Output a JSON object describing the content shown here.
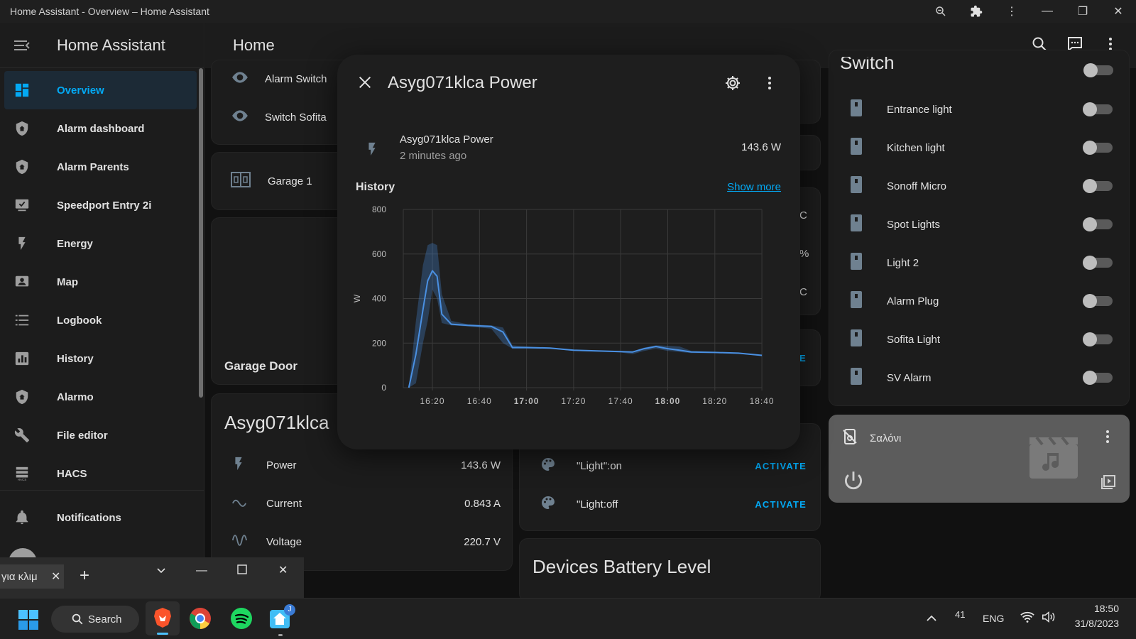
{
  "window": {
    "title": "Home Assistant - Overview – Home Assistant"
  },
  "sidebar": {
    "app_title": "Home Assistant",
    "items": [
      {
        "label": "Overview",
        "icon": "dashboard-icon",
        "active": true
      },
      {
        "label": "Alarm dashboard",
        "icon": "shield-home-icon"
      },
      {
        "label": "Alarm Parents",
        "icon": "shield-home-icon"
      },
      {
        "label": "Speedport Entry 2i",
        "icon": "monitor-icon"
      },
      {
        "label": "Energy",
        "icon": "lightning-icon"
      },
      {
        "label": "Map",
        "icon": "map-account-icon"
      },
      {
        "label": "Logbook",
        "icon": "list-icon"
      },
      {
        "label": "History",
        "icon": "chart-bar-icon"
      },
      {
        "label": "Alarmo",
        "icon": "shield-home-icon"
      },
      {
        "label": "File editor",
        "icon": "wrench-icon"
      },
      {
        "label": "HACS",
        "icon": "hacs-icon"
      }
    ],
    "notifications_label": "Notifications"
  },
  "header": {
    "title": "Home"
  },
  "left_cards": {
    "alarm_switch": "Alarm Switch",
    "switch_sofita": "Switch Sofita",
    "garage1": "Garage 1",
    "garage_door": "Garage Door",
    "asyg_title": "Asyg071klca",
    "rows": [
      {
        "label": "Power",
        "value": "143.6 W",
        "icon": "lightning-icon"
      },
      {
        "label": "Current",
        "value": "0.843 A",
        "icon": "current-ac-icon"
      },
      {
        "label": "Voltage",
        "value": "220.7 V",
        "icon": "sine-wave-icon"
      }
    ]
  },
  "middle_cards": {
    "units": [
      "C",
      "%",
      "C"
    ],
    "partial_activate": "E",
    "scenes": [
      {
        "label": "\"Light\":on",
        "action": "ACTIVATE"
      },
      {
        "label": "\"Light:off",
        "action": "ACTIVATE"
      }
    ],
    "battery_title": "Devices Battery Level"
  },
  "switch_card": {
    "title": "Switch",
    "items": [
      "Entrance light",
      "Kitchen light",
      "Sonoff Micro",
      "Spot Lights",
      "Light 2",
      "Alarm Plug",
      "Sofita Light",
      "SV Alarm"
    ]
  },
  "media_card": {
    "name": "Σαλόνι"
  },
  "dialog": {
    "title": "Asyg071klca Power",
    "entity_name": "Asyg071klca Power",
    "last_changed": "2 minutes ago",
    "state": "143.6 W",
    "history_label": "History",
    "show_more": "Show more"
  },
  "chart_data": {
    "type": "line",
    "title": "",
    "xlabel": "",
    "ylabel": "W",
    "ylim": [
      0,
      800
    ],
    "yticks": [
      0,
      200,
      400,
      600,
      800
    ],
    "xticks": [
      {
        "label": "16:20",
        "bold": false
      },
      {
        "label": "16:40",
        "bold": false
      },
      {
        "label": "17:00",
        "bold": true
      },
      {
        "label": "17:20",
        "bold": false
      },
      {
        "label": "17:40",
        "bold": false
      },
      {
        "label": "18:00",
        "bold": true
      },
      {
        "label": "18:20",
        "bold": false
      },
      {
        "label": "18:40",
        "bold": false
      }
    ],
    "grid": true,
    "series": [
      {
        "color": "#4a90e2",
        "x_minutes": [
          10,
          13,
          16,
          18,
          20,
          22,
          24,
          28,
          35,
          45,
          50,
          54,
          60,
          70,
          80,
          90,
          100,
          105,
          110,
          115,
          120,
          125,
          130,
          140,
          150,
          160
        ],
        "mean": [
          0,
          150,
          350,
          480,
          525,
          500,
          330,
          285,
          280,
          275,
          250,
          180,
          180,
          178,
          168,
          165,
          162,
          160,
          175,
          185,
          175,
          168,
          160,
          158,
          155,
          145
        ],
        "max": [
          0,
          300,
          550,
          640,
          650,
          640,
          420,
          300,
          285,
          280,
          270,
          190,
          185,
          180,
          170,
          167,
          165,
          163,
          180,
          190,
          188,
          185,
          165,
          160,
          157,
          148
        ],
        "min": [
          0,
          20,
          200,
          300,
          440,
          400,
          290,
          280,
          275,
          265,
          200,
          175,
          175,
          175,
          165,
          162,
          158,
          150,
          165,
          175,
          165,
          160,
          155,
          155,
          152,
          142
        ]
      }
    ]
  },
  "browser_strip": {
    "tab_label": "για κλιμ"
  },
  "taskbar": {
    "search_label": "Search",
    "lang": "ENG",
    "time": "18:50",
    "date": "31/8/2023",
    "tray_num": "41",
    "badge": "J"
  }
}
